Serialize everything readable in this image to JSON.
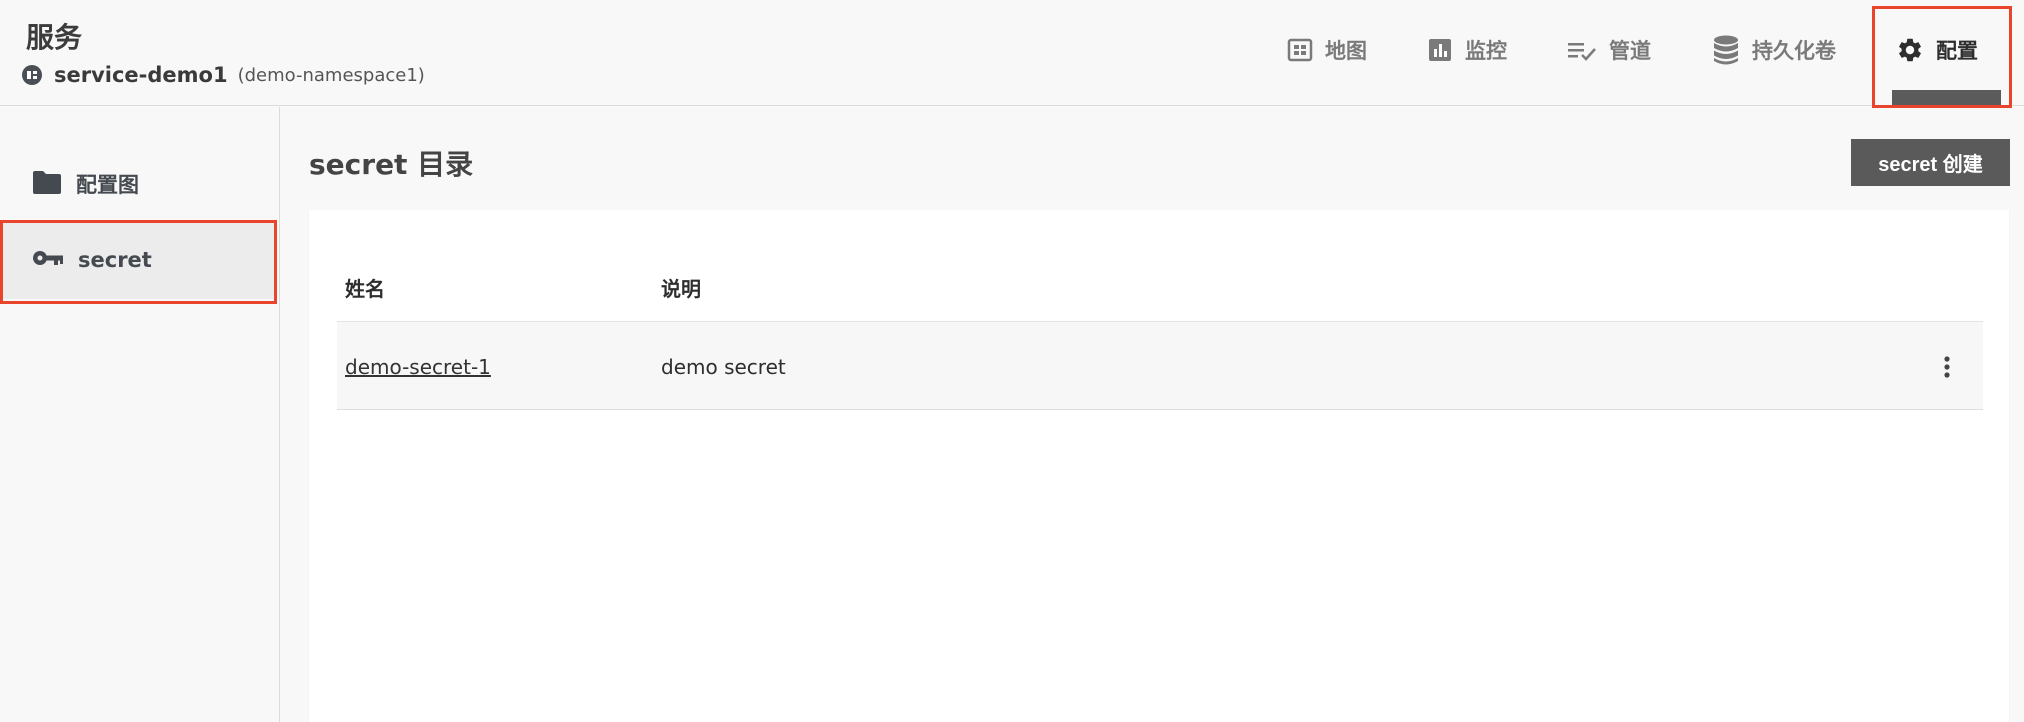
{
  "header": {
    "title": "服务",
    "service_name": "service-demo1",
    "namespace": "(demo-namespace1)"
  },
  "nav": {
    "items": [
      {
        "label": "地图",
        "icon": "map-icon"
      },
      {
        "label": "监控",
        "icon": "chart-icon"
      },
      {
        "label": "管道",
        "icon": "pipeline-icon"
      },
      {
        "label": "持久化卷",
        "icon": "database-icon"
      },
      {
        "label": "配置",
        "icon": "gear-icon",
        "active": true
      }
    ]
  },
  "sidebar": {
    "items": [
      {
        "label": "配置图",
        "icon": "folder-icon"
      },
      {
        "label": "secret",
        "icon": "key-icon",
        "selected": true
      }
    ]
  },
  "main": {
    "title": "secret 目录",
    "create_button": "secret 创建",
    "table": {
      "columns": [
        "姓名",
        "说明"
      ],
      "rows": [
        {
          "name": "demo-secret-1",
          "description": "demo secret"
        }
      ]
    }
  },
  "colors": {
    "highlight": "#e8452c",
    "button_bg": "#5a5a5a"
  }
}
